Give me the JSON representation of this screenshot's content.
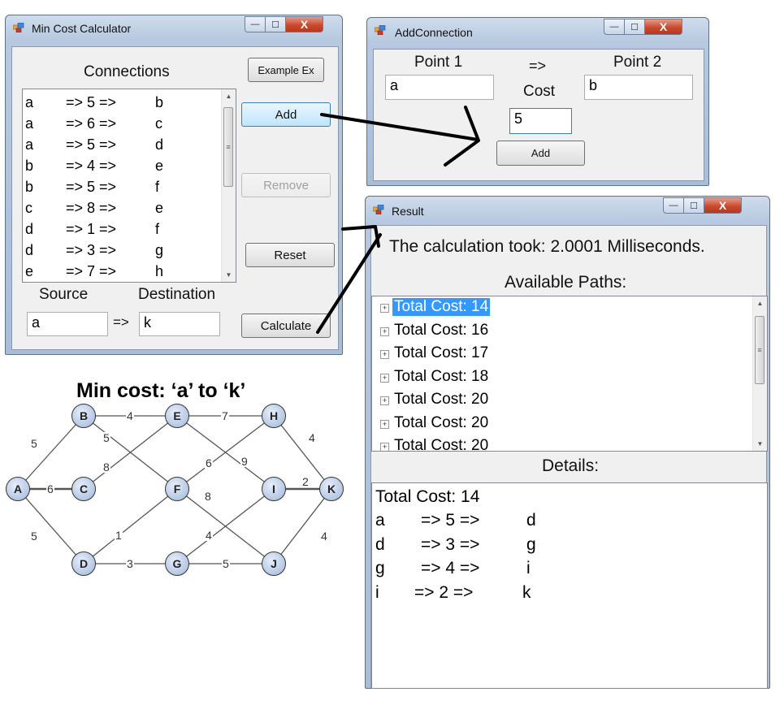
{
  "min_cost_window": {
    "title": "Min Cost Calculator",
    "connections_label": "Connections",
    "example_button": "Example Ex",
    "add_button": "Add",
    "remove_button": "Remove",
    "reset_button": "Reset",
    "calculate_button": "Calculate",
    "source_label": "Source",
    "destination_label": "Destination",
    "source_value": "a",
    "arrow": "=>",
    "destination_value": "k",
    "connections": [
      {
        "from": "a",
        "cost": "=> 5 =>",
        "to": "b"
      },
      {
        "from": "a",
        "cost": "=> 6 =>",
        "to": "c"
      },
      {
        "from": "a",
        "cost": "=> 5 =>",
        "to": "d"
      },
      {
        "from": "b",
        "cost": "=> 4 =>",
        "to": "e"
      },
      {
        "from": "b",
        "cost": "=> 5 =>",
        "to": "f"
      },
      {
        "from": "c",
        "cost": "=> 8 =>",
        "to": "e"
      },
      {
        "from": "d",
        "cost": "=> 1 =>",
        "to": "f"
      },
      {
        "from": "d",
        "cost": "=> 3 =>",
        "to": "g"
      },
      {
        "from": "e",
        "cost": "=> 7 =>",
        "to": "h"
      }
    ]
  },
  "add_connection_window": {
    "title": "AddConnection",
    "point1_label": "Point 1",
    "point2_label": "Point 2",
    "arrow": "=>",
    "cost_label": "Cost",
    "point1_value": "a",
    "point2_value": "b",
    "cost_value": "5",
    "add_button": "Add"
  },
  "result_window": {
    "title": "Result",
    "timing": "The calculation took: 2.0001 Milliseconds.",
    "paths_label": "Available Paths:",
    "paths": [
      "Total Cost: 14",
      "Total Cost: 16",
      "Total Cost: 17",
      "Total Cost: 18",
      "Total Cost: 20",
      "Total Cost: 20",
      "Total Cost: 20"
    ],
    "details_label": "Details:",
    "details_total": "Total Cost: 14",
    "details_rows": [
      {
        "from": "a",
        "cost": "=> 5 =>",
        "to": "d"
      },
      {
        "from": "d",
        "cost": "=> 3 =>",
        "to": "g"
      },
      {
        "from": "g",
        "cost": "=> 4 =>",
        "to": "i"
      },
      {
        "from": "i",
        "cost": "=> 2 =>",
        "to": "k"
      }
    ]
  },
  "graph": {
    "title": "Min cost: ‘a’ to ‘k’",
    "nodes": [
      "A",
      "B",
      "C",
      "D",
      "E",
      "F",
      "G",
      "H",
      "I",
      "J",
      "K"
    ],
    "edge_labels": [
      "5",
      "6",
      "5",
      "4",
      "5",
      "8",
      "1",
      "3",
      "7",
      "6",
      "9",
      "8",
      "4",
      "5",
      "4",
      "2",
      "4"
    ]
  },
  "window_buttons": {
    "minimize": "—",
    "maximize": "☐",
    "close": "X"
  },
  "colors": {
    "selection": "#3399ff",
    "close_button": "#c94a30"
  }
}
